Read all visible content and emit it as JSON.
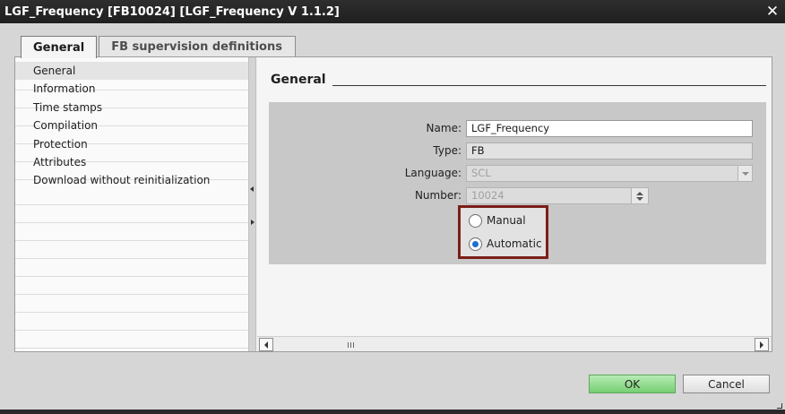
{
  "window": {
    "title": "LGF_Frequency [FB10024] [LGF_Frequency V 1.1.2]",
    "close_glyph": "✕"
  },
  "tabs": [
    {
      "label": "General",
      "active": true
    },
    {
      "label": "FB supervision definitions",
      "active": false
    }
  ],
  "nav": {
    "items": [
      {
        "label": "General",
        "selected": true
      },
      {
        "label": "Information"
      },
      {
        "label": "Time stamps"
      },
      {
        "label": "Compilation"
      },
      {
        "label": "Protection"
      },
      {
        "label": "Attributes"
      },
      {
        "label": "Download without reinitialization"
      }
    ]
  },
  "section": {
    "title": "General",
    "fields": {
      "name": {
        "label": "Name:",
        "value": "LGF_Frequency"
      },
      "type": {
        "label": "Type:",
        "value": "FB"
      },
      "language": {
        "label": "Language:",
        "value": "SCL"
      },
      "number": {
        "label": "Number:",
        "value": "10024"
      }
    },
    "numbering": {
      "options": [
        {
          "label": "Manual",
          "checked": false
        },
        {
          "label": "Automatic",
          "checked": true
        }
      ],
      "highlight_color": "#7a1f18"
    }
  },
  "scrollbar": {
    "grip": "III"
  },
  "buttons": {
    "ok": "OK",
    "cancel": "Cancel"
  },
  "colors": {
    "ok_button": "#76cf72",
    "title_bar": "#2e2e2e",
    "radio_selected": "#1e6fd1"
  }
}
